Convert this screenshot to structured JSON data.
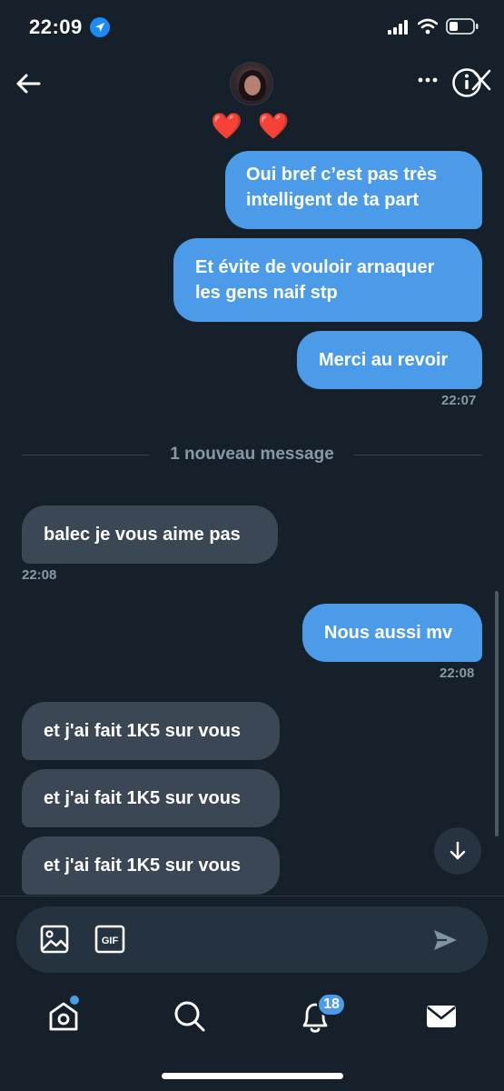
{
  "status_bar": {
    "time": "22:09",
    "icons": [
      "location-arrow-icon",
      "cellular-signal-icon",
      "wifi-icon",
      "battery-icon"
    ]
  },
  "header": {
    "profile_name": "❤️ ❤️",
    "icons": [
      "back-arrow-icon",
      "more-options-icon",
      "info-icon"
    ]
  },
  "messages": [
    {
      "id": "m1",
      "side": "sent",
      "lines": [
        "Oui bref c’est pas très",
        "intelligent de ta part"
      ]
    },
    {
      "id": "m2",
      "side": "sent",
      "lines": [
        "Et évite de vouloir arnaquer",
        "les gens naif stp"
      ]
    },
    {
      "id": "m3",
      "side": "sent",
      "lines": [
        "Merci au revoir"
      ],
      "time": "22:07"
    },
    {
      "id": "m4",
      "side": "received",
      "lines": [
        "balec je vous aime pas"
      ],
      "time": "22:08"
    },
    {
      "id": "m5",
      "side": "sent",
      "lines": [
        "Nous aussi mv"
      ],
      "time": "22:08"
    },
    {
      "id": "m6",
      "side": "received",
      "lines": [
        "et j'ai fait 1K5 sur vous"
      ]
    },
    {
      "id": "m7",
      "side": "received",
      "lines": [
        "et j'ai fait 1K5 sur vous"
      ]
    },
    {
      "id": "m8",
      "side": "received",
      "lines": [
        "et j'ai fait 1K5 sur vous"
      ]
    }
  ],
  "divider": {
    "label": "1 nouveau message"
  },
  "composer": {
    "icons": [
      "image-icon",
      "gif-icon",
      "send-icon"
    ],
    "gif_label": "GIF"
  },
  "tab_bar": {
    "tabs": [
      "home",
      "search",
      "notifications",
      "messages"
    ],
    "notifications_badge": "18"
  },
  "colors": {
    "background": "#15202b",
    "sent_bubble": "#4b9be8",
    "received_bubble": "#3b4754",
    "timestamp": "#8899a6",
    "accent": "#4b9be8"
  }
}
